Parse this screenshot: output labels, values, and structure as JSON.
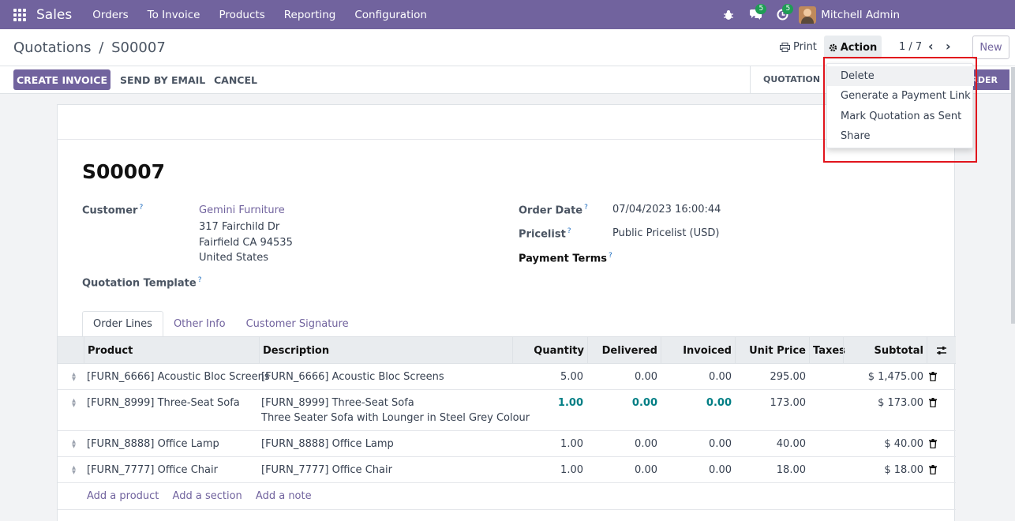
{
  "navbar": {
    "app_name": "Sales",
    "menu": [
      "Orders",
      "To Invoice",
      "Products",
      "Reporting",
      "Configuration"
    ],
    "messages_badge": "5",
    "activities_badge": "5",
    "user": "Mitchell Admin"
  },
  "control_panel": {
    "breadcrumb_parent": "Quotations",
    "breadcrumb_sep": "/",
    "breadcrumb_current": "S00007",
    "print_label": "Print",
    "action_label": "Action",
    "pager": "1 / 7",
    "new_label": "New"
  },
  "statusbar": {
    "create_invoice": "CREATE INVOICE",
    "send_by_email": "SEND BY EMAIL",
    "cancel": "CANCEL",
    "stage_quotation": "QUOTATION",
    "stage_sales_order_partial": "RDER"
  },
  "action_menu": {
    "items": [
      "Delete",
      "Generate a Payment Link",
      "Mark Quotation as Sent",
      "Share"
    ]
  },
  "form": {
    "order_name": "S00007",
    "customer_label": "Customer",
    "customer_name": "Gemini Furniture",
    "customer_address": [
      "317 Fairchild Dr",
      "Fairfield CA 94535",
      "United States"
    ],
    "quotation_template_label": "Quotation Template",
    "order_date_label": "Order Date",
    "order_date": "07/04/2023 16:00:44",
    "pricelist_label": "Pricelist",
    "pricelist": "Public Pricelist (USD)",
    "payment_terms_label": "Payment Terms",
    "help_mark": "?"
  },
  "tabs": [
    "Order Lines",
    "Other Info",
    "Customer Signature"
  ],
  "table": {
    "columns": [
      "Product",
      "Description",
      "Quantity",
      "Delivered",
      "Invoiced",
      "Unit Price",
      "Taxes",
      "Subtotal"
    ],
    "rows": [
      {
        "product": "[FURN_6666] Acoustic Bloc Screens",
        "description": "[FURN_6666] Acoustic Bloc Screens",
        "description2": "",
        "quantity": "5.00",
        "delivered": "0.00",
        "invoiced": "0.00",
        "unit_price": "295.00",
        "subtotal": "$ 1,475.00"
      },
      {
        "product": "[FURN_8999] Three-Seat Sofa",
        "description": "[FURN_8999] Three-Seat Sofa",
        "description2": "Three Seater Sofa with Lounger in Steel Grey Colour",
        "quantity": "1.00",
        "delivered": "0.00",
        "invoiced": "0.00",
        "unit_price": "173.00",
        "subtotal": "$ 173.00"
      },
      {
        "product": "[FURN_8888] Office Lamp",
        "description": "[FURN_8888] Office Lamp",
        "description2": "",
        "quantity": "1.00",
        "delivered": "0.00",
        "invoiced": "0.00",
        "unit_price": "40.00",
        "subtotal": "$ 40.00"
      },
      {
        "product": "[FURN_7777] Office Chair",
        "description": "[FURN_7777] Office Chair",
        "description2": "",
        "quantity": "1.00",
        "delivered": "0.00",
        "invoiced": "0.00",
        "unit_price": "18.00",
        "subtotal": "$ 18.00"
      }
    ],
    "add_product": "Add a product",
    "add_section": "Add a section",
    "add_note": "Add a note"
  },
  "colors": {
    "brand": "#71639e",
    "highlight": "#e1141c",
    "teal": "#017e84"
  }
}
